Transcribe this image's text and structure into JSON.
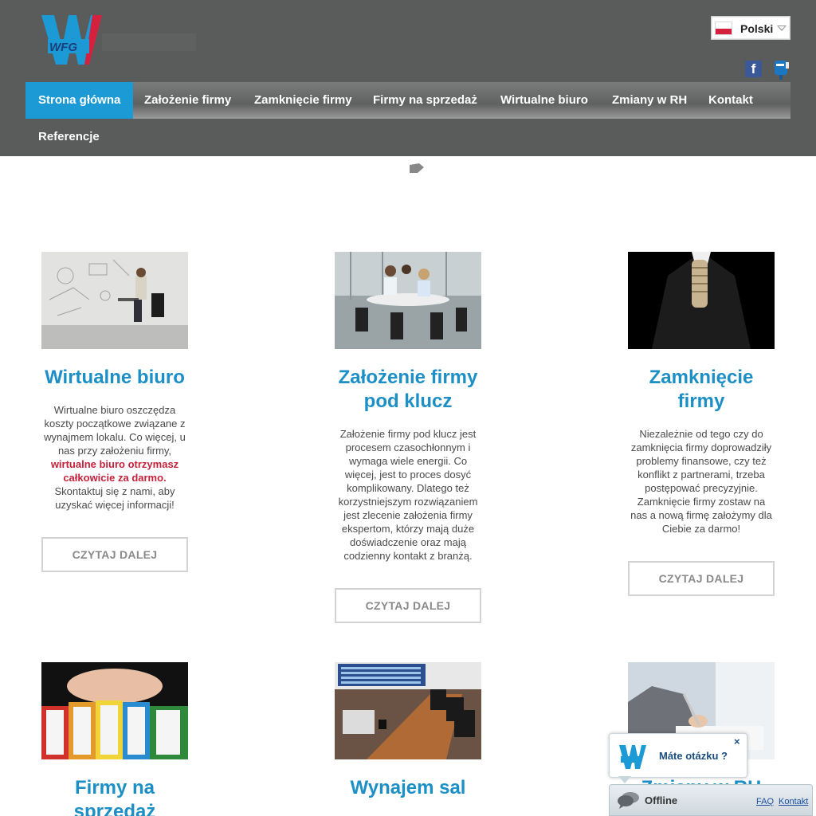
{
  "brand": {
    "logo_text": "WFG"
  },
  "language": {
    "label": "Polski"
  },
  "nav": {
    "items": [
      {
        "label": "Strona główna"
      },
      {
        "label": "Założenie firmy"
      },
      {
        "label": "Zamknięcie firmy"
      },
      {
        "label": "Firmy na sprzedaż"
      },
      {
        "label": "Wirtualne biuro"
      },
      {
        "label": "Zmiany w RH"
      },
      {
        "label": "Kontakt"
      },
      {
        "label": "Referencje"
      }
    ]
  },
  "cards": [
    {
      "title": "Wirtualne biuro",
      "desc_pre": "Wirtualne biuro oszczędza koszty początkowe związane z wynajmem lokalu. Co więcej, u nas przy założeniu firmy,",
      "desc_highlight": "wirtualne biuro otrzymasz całkowicie za darmo.",
      "desc_post": "Skontaktuj się z nami, aby uzyskać więcej informacji!",
      "button": "CZYTAJ DALEJ"
    },
    {
      "title": "Założenie firmy pod klucz",
      "desc": "Założenie firmy pod klucz jest procesem czasochłonnym i wymaga wiele energii. Co więcej, jest to proces dosyć komplikowany. Dlatego też korzystniejszym rozwiązaniem jest zlecenie założenia firmy ekspertom, którzy mają duże doświadczenie oraz mają codzienny kontakt z branżą.",
      "button": "CZYTAJ DALEJ"
    },
    {
      "title": "Zamknięcie firmy",
      "desc": "Niezależnie od tego czy do zamknięcia firmy doprowadziły problemy finansowe, czy też konflikt z partnerami, trzeba postępować precyzyjnie. Zamknięcie firmy zostaw na nas a nową firmę założymy dla Ciebie za darmo!",
      "button": "CZYTAJ DALEJ"
    },
    {
      "title": "Firmy na sprzedaż"
    },
    {
      "title": "Wynajem sal"
    },
    {
      "title": "Zmiany w RH"
    }
  ],
  "chat": {
    "question": "Máte otázku ?",
    "close": "×",
    "status": "Offline",
    "faq": "FAQ",
    "kontakt": "Kontakt"
  },
  "colors": {
    "header_bg": "#5a5b5b",
    "nav_active": "#1c9ad6",
    "title_blue": "#1c8fc6",
    "highlight_red": "#c4213b"
  },
  "icons": [
    "facebook-icon",
    "mailbox-icon",
    "flag-poland-icon",
    "chat-icon"
  ]
}
